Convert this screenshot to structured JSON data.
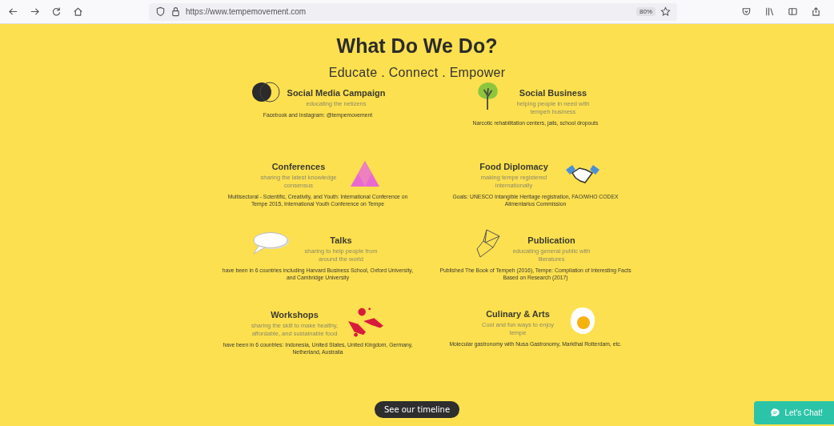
{
  "browser": {
    "url": "https://www.tempemovement.com",
    "zoom": "80%"
  },
  "heading": "What Do We Do?",
  "tagline": "Educate . Connect . Empower",
  "activities": [
    {
      "title": "Social Media Campaign",
      "subtitle": "educating the netizens",
      "detail": "Facebook and Instagram: @tempemovement",
      "kind": "left"
    },
    {
      "title": "Social Business",
      "subtitle": "helping people in need with tempeh business",
      "detail": "Narcotic rehabilitation centers, jails, school dropouts",
      "kind": "left"
    },
    {
      "title": "Conferences",
      "subtitle": "sharing the latest knowledge consensus",
      "detail": "Multisectoral - Scientific, Creativity, and Youth: International Conference on Tempe 2015, International Youth Conference on Tempe",
      "kind": "right"
    },
    {
      "title": "Food Diplomacy",
      "subtitle": "making tempe registered internationally",
      "detail": "Goals: UNESCO Intangible Heritage registration, FAO/WHO CODEX Alimentarius Commission",
      "kind": "right"
    },
    {
      "title": "Talks",
      "subtitle": "sharing to help people from around the world",
      "detail": "have been in 6 countries including Harvard Business School, Oxford University, and Cambridge University",
      "kind": "left"
    },
    {
      "title": "Publication",
      "subtitle": "educating general public with literatures",
      "detail": "Published The Book of Tempeh (2016), Tempe: Compilation of Interesting Facts Based on Research (2017)",
      "kind": "left"
    },
    {
      "title": "Workshops",
      "subtitle": "sharing the skill to make healthy, affordable, and sustainable food",
      "detail": "have been in 6 countries: Indonesia, United States, United Kingdom, Germany, Netherland, Australia",
      "kind": "right"
    },
    {
      "title": "Culinary & Arts",
      "subtitle": "Cool and fun ways to enjoy tempe",
      "detail": "Molecular gastronomy with Nusa Gastronomy, Markthal Rotterdam, etc.",
      "kind": "right"
    }
  ],
  "timeline_button": "See our timeline",
  "chat_button": "Let's Chat!"
}
